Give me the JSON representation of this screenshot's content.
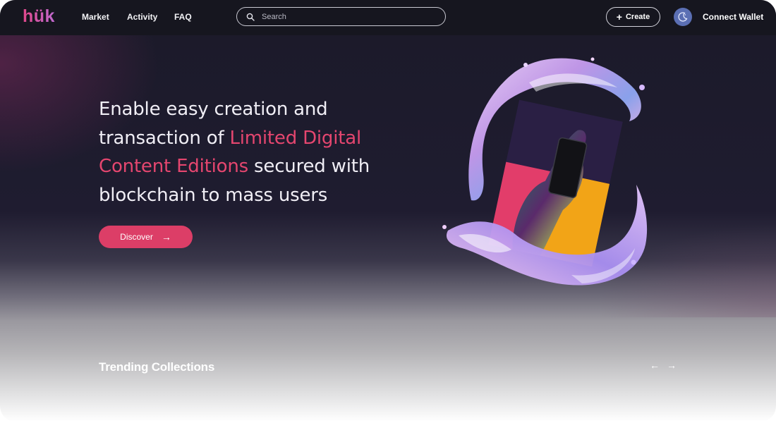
{
  "nav": {
    "logo": "hük",
    "links": [
      "Market",
      "Activity",
      "FAQ"
    ],
    "search_placeholder": "Search",
    "create_label": "Create",
    "connect_label": "Connect Wallet"
  },
  "hero": {
    "line1": "Enable easy creation and",
    "line2_pre": "transaction of ",
    "accent_1": "Limited Digital",
    "accent_2": "Content Editions",
    "line3_post": " secured with",
    "line4": "blockchain to mass users",
    "cta_label": "Discover",
    "cta_icon": "arrow-right-icon"
  },
  "trending": {
    "title": "Trending Collections",
    "prev_icon": "arrow-left-icon",
    "next_icon": "arrow-right-icon"
  },
  "colors": {
    "accent": "#e5466f",
    "button": "#dc3e67",
    "nav_bg": "#16161f",
    "avatar": "#5b6fb4"
  }
}
